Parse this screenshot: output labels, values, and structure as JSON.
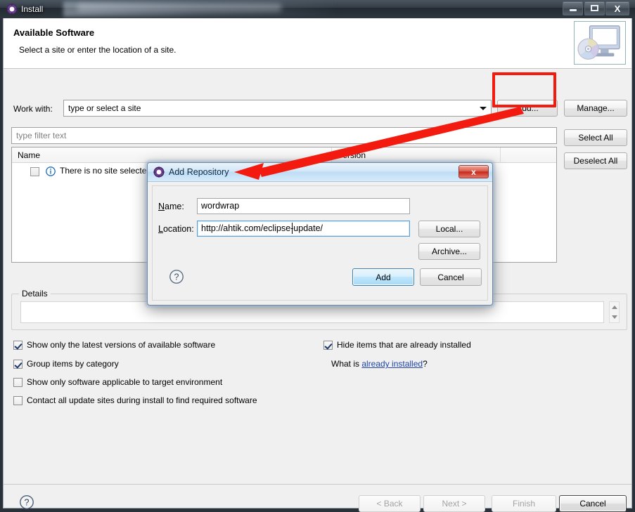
{
  "window": {
    "title": "Install",
    "icon": "eclipse-gear-icon",
    "controls": {
      "minimize": "–",
      "maximize": "□",
      "close": "X"
    }
  },
  "header": {
    "title": "Available Software",
    "subtitle": "Select a site or enter the location of a site.",
    "banner_icon": "monitor-with-disc-icon"
  },
  "workwith": {
    "label": "Work with:",
    "value": "type or select a site",
    "placeholder": "type or select a site",
    "dropdown_icon": "chevron-down-icon"
  },
  "buttons": {
    "add": "Add...",
    "manage": "Manage...",
    "select_all": "Select All",
    "deselect_all": "Deselect All"
  },
  "filter": {
    "placeholder": "type filter text",
    "value": ""
  },
  "table": {
    "columns": [
      "Name",
      "Version",
      ""
    ],
    "rows": [
      {
        "checkbox": false,
        "icon": "info-icon",
        "name": "There is no site selected.",
        "version": ""
      }
    ]
  },
  "details": {
    "legend": "Details",
    "value": ""
  },
  "options": [
    {
      "label": "Show only the latest versions of available software",
      "checked": true
    },
    {
      "label": "Group items by category",
      "checked": true
    },
    {
      "label": "Show only software applicable to target environment",
      "checked": false
    },
    {
      "label": "Contact all update sites during install to find required software",
      "checked": false
    },
    {
      "label": "Hide items that are already installed",
      "checked": true
    }
  ],
  "whatis": {
    "prefix": "What is ",
    "link": "already installed",
    "suffix": "?"
  },
  "wizard_buttons": {
    "help_icon": "help-question-icon",
    "back": "< Back",
    "next": "Next >",
    "finish": "Finish",
    "cancel": "Cancel"
  },
  "dialog": {
    "title": "Add Repository",
    "icon": "eclipse-gear-icon",
    "close": "x",
    "name_label": "Name:",
    "name_mnemonic": "N",
    "name_value": "wordwrap",
    "location_label": "Location:",
    "location_mnemonic": "L",
    "location_value": "http://ahtik.com/eclipse-update/",
    "local_button": "Local...",
    "archive_button": "Archive...",
    "add_button": "Add",
    "cancel_button": "Cancel",
    "help_icon": "help-question-icon"
  },
  "annotations": {
    "color": "#f31b10",
    "highlight_target": "Add...",
    "arrow_from": "add-button",
    "arrow_to": "add-repository-dialog-title"
  }
}
